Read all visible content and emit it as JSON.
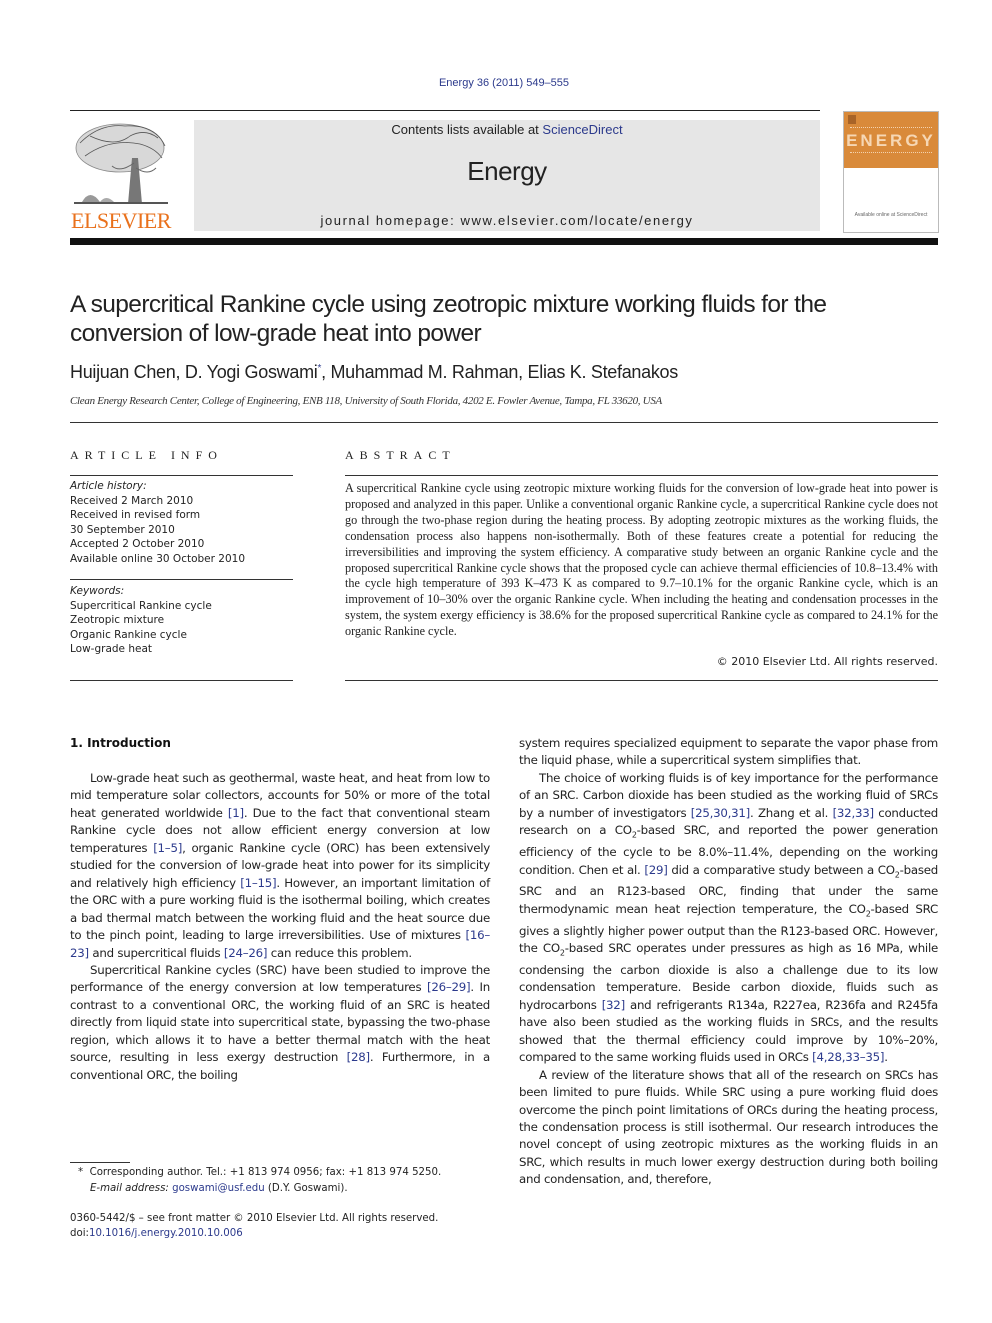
{
  "header": {
    "citation": "Energy 36 (2011) 549–555",
    "contents_prefix": "Contents lists available at ",
    "contents_link": "ScienceDirect",
    "journal_name": "Energy",
    "homepage": "journal homepage: www.elsevier.com/locate/energy",
    "publisher_logo_text": "ELSEVIER",
    "cover_title": "ENERGY",
    "cover_footer": "Available online at ScienceDirect",
    "brand_color": "#e9711c",
    "cover_color": "#d98a3a",
    "link_color": "#2c3a8c"
  },
  "article": {
    "title": "A supercritical Rankine cycle using zeotropic mixture working fluids for the conversion of low-grade heat into power",
    "authors": [
      {
        "name": "Huijuan Chen",
        "mark": ""
      },
      {
        "name": "D. Yogi Goswami",
        "mark": "*"
      },
      {
        "name": "Muhammad M. Rahman",
        "mark": ""
      },
      {
        "name": "Elias K. Stefanakos",
        "mark": ""
      }
    ],
    "affiliation": "Clean Energy Research Center, College of Engineering, ENB 118, University of South Florida, 4202 E. Fowler Avenue, Tampa, FL 33620, USA"
  },
  "article_info": {
    "heading": "ARTICLE INFO",
    "history_label": "Article history:",
    "history": [
      "Received 2 March 2010",
      "Received in revised form",
      "30 September 2010",
      "Accepted 2 October 2010",
      "Available online 30 October 2010"
    ],
    "keywords_label": "Keywords:",
    "keywords": [
      "Supercritical Rankine cycle",
      "Zeotropic mixture",
      "Organic Rankine cycle",
      "Low-grade heat"
    ]
  },
  "abstract": {
    "heading": "ABSTRACT",
    "text": "A supercritical Rankine cycle using zeotropic mixture working fluids for the conversion of low-grade heat into power is proposed and analyzed in this paper. Unlike a conventional organic Rankine cycle, a supercritical Rankine cycle does not go through the two-phase region during the heating process. By adopting zeotropic mixtures as the working fluids, the condensation process also happens non-isothermally. Both of these features create a potential for reducing the irreversibilities and improving the system efficiency. A comparative study between an organic Rankine cycle and the proposed supercritical Rankine cycle shows that the proposed cycle can achieve thermal efficiencies of 10.8–13.4% with the cycle high temperature of 393 K–473 K as compared to 9.7–10.1% for the organic Rankine cycle, which is an improvement of 10–30% over the organic Rankine cycle. When including the heating and condensation processes in the system, the system exergy efficiency is 38.6% for the proposed supercritical Rankine cycle as compared to 24.1% for the organic Rankine cycle.",
    "copyright": "© 2010 Elsevier Ltd. All rights reserved."
  },
  "body": {
    "section_heading": "1.  Introduction",
    "left_paragraphs": [
      [
        {
          "t": "Low-grade heat such as geothermal, waste heat, and heat from low to mid temperature solar collectors, accounts for 50% or more of the total heat generated worldwide "
        },
        {
          "ref": "[1]"
        },
        {
          "t": ". Due to the fact that conventional steam Rankine cycle does not allow efficient energy conversion at low temperatures "
        },
        {
          "ref": "[1–5]"
        },
        {
          "t": ", organic Rankine cycle (ORC) has been extensively studied for the conversion of low-grade heat into power for its simplicity and relatively high efficiency "
        },
        {
          "ref": "[1–15]"
        },
        {
          "t": ". However, an important limitation of the ORC with a pure working fluid is the isothermal boiling, which creates a bad thermal match between the working fluid and the heat source due to the pinch point, leading to large irreversibilities. Use of mixtures "
        },
        {
          "ref": "[16–23]"
        },
        {
          "t": " and supercritical fluids "
        },
        {
          "ref": "[24–26]"
        },
        {
          "t": " can reduce this problem."
        }
      ],
      [
        {
          "t": "Supercritical Rankine cycles (SRC) have been studied to improve the performance of the energy conversion at low temperatures "
        },
        {
          "ref": "[26–29]"
        },
        {
          "t": ". In contrast to a conventional ORC, the working fluid of an SRC is heated directly from liquid state into supercritical state, bypassing the two-phase region, which allows it to have a better thermal match with the heat source, resulting in less exergy destruction "
        },
        {
          "ref": "[28]"
        },
        {
          "t": ". Furthermore, in a conventional ORC, the boiling"
        }
      ]
    ],
    "right_paragraphs": [
      [
        {
          "t": "system requires specialized equipment to separate the vapor phase from the liquid phase, while a supercritical system simplifies that."
        }
      ],
      [
        {
          "t": "The choice of working fluids is of key importance for the performance of an SRC. Carbon dioxide has been studied as the working fluid of SRCs by a number of investigators "
        },
        {
          "ref": "[25,30,31]"
        },
        {
          "t": ". Zhang et al. "
        },
        {
          "ref": "[32,33]"
        },
        {
          "t": " conducted research on a CO"
        },
        {
          "sub": "2"
        },
        {
          "t": "-based SRC, and reported the power generation efficiency of the cycle to be 8.0%–11.4%, depending on the working condition. Chen et al. "
        },
        {
          "ref": "[29]"
        },
        {
          "t": " did a comparative study between a CO"
        },
        {
          "sub": "2"
        },
        {
          "t": "-based SRC and an R123-based ORC, finding that under the same thermodynamic mean heat rejection temperature, the CO"
        },
        {
          "sub": "2"
        },
        {
          "t": "-based SRC gives a slightly higher power output than the R123-based ORC. However, the CO"
        },
        {
          "sub": "2"
        },
        {
          "t": "-based SRC operates under pressures as high as 16 MPa, while condensing the carbon dioxide is also a challenge due to its low condensation temperature. Beside carbon dioxide, fluids such as hydrocarbons "
        },
        {
          "ref": "[32]"
        },
        {
          "t": " and refrigerants R134a, R227ea, R236fa and R245fa have also been studied as the working fluids in SRCs, and the results showed that the thermal efficiency could improve by 10%–20%, compared to the same working fluids used in ORCs "
        },
        {
          "ref": "[4,28,33–35]"
        },
        {
          "t": "."
        }
      ],
      [
        {
          "t": "A review of the literature shows that all of the research on SRCs has been limited to pure fluids. While SRC using a pure working fluid does overcome the pinch point limitations of ORCs during the heating process, the condensation process is still isothermal. Our research introduces the novel concept of using zeotropic mixtures as the working fluids in an SRC, which results in much lower exergy destruction during both boiling and condensation, and, therefore,"
        }
      ]
    ]
  },
  "footnote": {
    "mark": "*",
    "text": "Corresponding author. Tel.: +1 813 974 0956; fax: +1 813 974 5250.",
    "email_label": "E-mail address:",
    "email": "goswami@usf.edu",
    "email_suffix": " (D.Y. Goswami)."
  },
  "front_matter": {
    "issn_line": "0360-5442/$ – see front matter © 2010 Elsevier Ltd. All rights reserved.",
    "doi_prefix": "doi:",
    "doi": "10.1016/j.energy.2010.10.006"
  }
}
